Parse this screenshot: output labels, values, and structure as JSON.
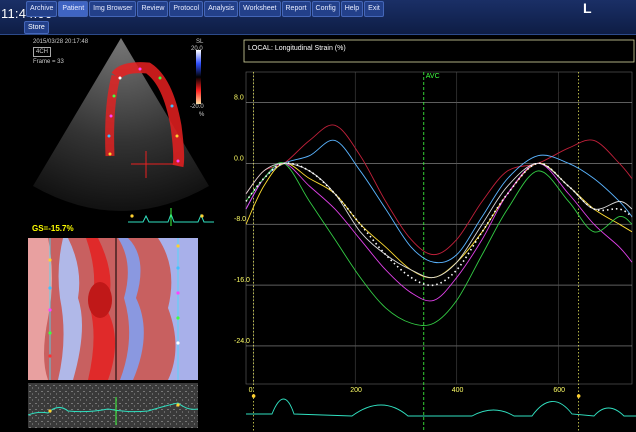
{
  "clock": "11:44:06",
  "menu": [
    {
      "label": "Archive",
      "name": "menu-archive"
    },
    {
      "label": "Patient",
      "name": "menu-patient"
    },
    {
      "label": "Img Browser",
      "name": "menu-img-browser"
    },
    {
      "label": "Review",
      "name": "menu-review"
    },
    {
      "label": "Protocol",
      "name": "menu-protocol"
    },
    {
      "label": "Analysis",
      "name": "menu-analysis"
    },
    {
      "label": "Worksheet",
      "name": "menu-worksheet"
    },
    {
      "label": "Report",
      "name": "menu-report"
    },
    {
      "label": "Config",
      "name": "menu-config"
    },
    {
      "label": "Help",
      "name": "menu-help"
    },
    {
      "label": "Exit",
      "name": "menu-exit"
    }
  ],
  "store_label": "Store",
  "logo": "L",
  "echo": {
    "timestamp": "2015/03/28 20:17:48",
    "view": "4CH",
    "frame": "Frame = 33",
    "scale_label": "SL",
    "scale_max": "20.0",
    "scale_min": "-20.0",
    "scale_unit": "%"
  },
  "gs_text": "GS=-15.7%",
  "chart_data": {
    "type": "line",
    "title": "LOCAL: Longitudinal Strain (%)",
    "annotation": "AVC",
    "avc_x": 335,
    "x_range": [
      -15,
      745
    ],
    "y_range": [
      -29,
      12
    ],
    "y_ticks": [
      8.0,
      0.0,
      -8.0,
      -16.0,
      -24.0
    ],
    "y_tick_labels": [
      "8.0",
      "0.0",
      "-8.0",
      "-16.0",
      "-24.0"
    ],
    "x_ticks": [
      0,
      200,
      400,
      600
    ],
    "x_tick_labels": [
      "0",
      "200",
      "400",
      "600"
    ],
    "grid": true,
    "series": [
      {
        "color": "#c0203a",
        "points": [
          [
            -15,
            -4
          ],
          [
            20,
            -1
          ],
          [
            60,
            0
          ],
          [
            110,
            3
          ],
          [
            160,
            5
          ],
          [
            210,
            1
          ],
          [
            260,
            -5
          ],
          [
            310,
            -10
          ],
          [
            355,
            -12
          ],
          [
            400,
            -10
          ],
          [
            450,
            -5
          ],
          [
            500,
            -1
          ],
          [
            560,
            0
          ],
          [
            620,
            2
          ],
          [
            670,
            3
          ],
          [
            720,
            0
          ],
          [
            745,
            -2
          ]
        ]
      },
      {
        "color": "#5ab4ff",
        "points": [
          [
            -15,
            -6
          ],
          [
            20,
            -2
          ],
          [
            60,
            0
          ],
          [
            110,
            1
          ],
          [
            160,
            3
          ],
          [
            210,
            -1
          ],
          [
            260,
            -6
          ],
          [
            310,
            -11
          ],
          [
            355,
            -13
          ],
          [
            400,
            -12
          ],
          [
            450,
            -7
          ],
          [
            500,
            -2
          ],
          [
            560,
            1
          ],
          [
            620,
            0
          ],
          [
            670,
            -2
          ],
          [
            720,
            -5
          ],
          [
            745,
            -7
          ]
        ]
      },
      {
        "color": "#ffdd33",
        "points": [
          [
            -15,
            -8
          ],
          [
            20,
            -3
          ],
          [
            60,
            0
          ],
          [
            110,
            -2
          ],
          [
            160,
            -4
          ],
          [
            210,
            -8
          ],
          [
            260,
            -11
          ],
          [
            310,
            -14
          ],
          [
            355,
            -15
          ],
          [
            400,
            -13
          ],
          [
            450,
            -9
          ],
          [
            500,
            -4
          ],
          [
            560,
            0
          ],
          [
            620,
            -3
          ],
          [
            670,
            -6
          ],
          [
            720,
            -8
          ],
          [
            745,
            -9
          ]
        ]
      },
      {
        "color": "#e040e8",
        "points": [
          [
            -15,
            -6
          ],
          [
            20,
            -2
          ],
          [
            60,
            0
          ],
          [
            110,
            -3
          ],
          [
            160,
            -6
          ],
          [
            210,
            -10
          ],
          [
            260,
            -14
          ],
          [
            310,
            -17
          ],
          [
            355,
            -18
          ],
          [
            400,
            -15
          ],
          [
            450,
            -10
          ],
          [
            500,
            -4
          ],
          [
            560,
            0
          ],
          [
            620,
            -4
          ],
          [
            670,
            -8
          ],
          [
            720,
            -11
          ],
          [
            745,
            -13
          ]
        ]
      },
      {
        "color": "#33cc44",
        "points": [
          [
            -15,
            -5
          ],
          [
            20,
            -2
          ],
          [
            60,
            0
          ],
          [
            110,
            -5
          ],
          [
            160,
            -10
          ],
          [
            210,
            -15
          ],
          [
            260,
            -19
          ],
          [
            310,
            -21
          ],
          [
            355,
            -21
          ],
          [
            400,
            -18
          ],
          [
            450,
            -12
          ],
          [
            500,
            -6
          ],
          [
            560,
            -1
          ],
          [
            620,
            -5
          ],
          [
            670,
            -9
          ],
          [
            720,
            -7
          ],
          [
            745,
            -8
          ]
        ]
      },
      {
        "color": "#d8d8d8",
        "points": [
          [
            -15,
            -4
          ],
          [
            20,
            -1
          ],
          [
            60,
            0
          ],
          [
            110,
            -1
          ],
          [
            160,
            -4
          ],
          [
            210,
            -9
          ],
          [
            260,
            -12
          ],
          [
            310,
            -14
          ],
          [
            355,
            -15
          ],
          [
            400,
            -13
          ],
          [
            450,
            -8
          ],
          [
            500,
            -3
          ],
          [
            560,
            0
          ],
          [
            620,
            -3
          ],
          [
            670,
            -6
          ],
          [
            720,
            -5
          ],
          [
            745,
            -6
          ]
        ]
      }
    ],
    "average": {
      "color": "#ffffff",
      "points": [
        [
          -15,
          -5
        ],
        [
          20,
          -2
        ],
        [
          60,
          0
        ],
        [
          110,
          -1
        ],
        [
          160,
          -4
        ],
        [
          210,
          -8
        ],
        [
          260,
          -12
        ],
        [
          310,
          -15
        ],
        [
          355,
          -16
        ],
        [
          400,
          -14
        ],
        [
          450,
          -9
        ],
        [
          500,
          -4
        ],
        [
          560,
          0
        ],
        [
          620,
          -3
        ],
        [
          670,
          -6
        ],
        [
          720,
          -6
        ],
        [
          745,
          -7
        ]
      ]
    }
  }
}
